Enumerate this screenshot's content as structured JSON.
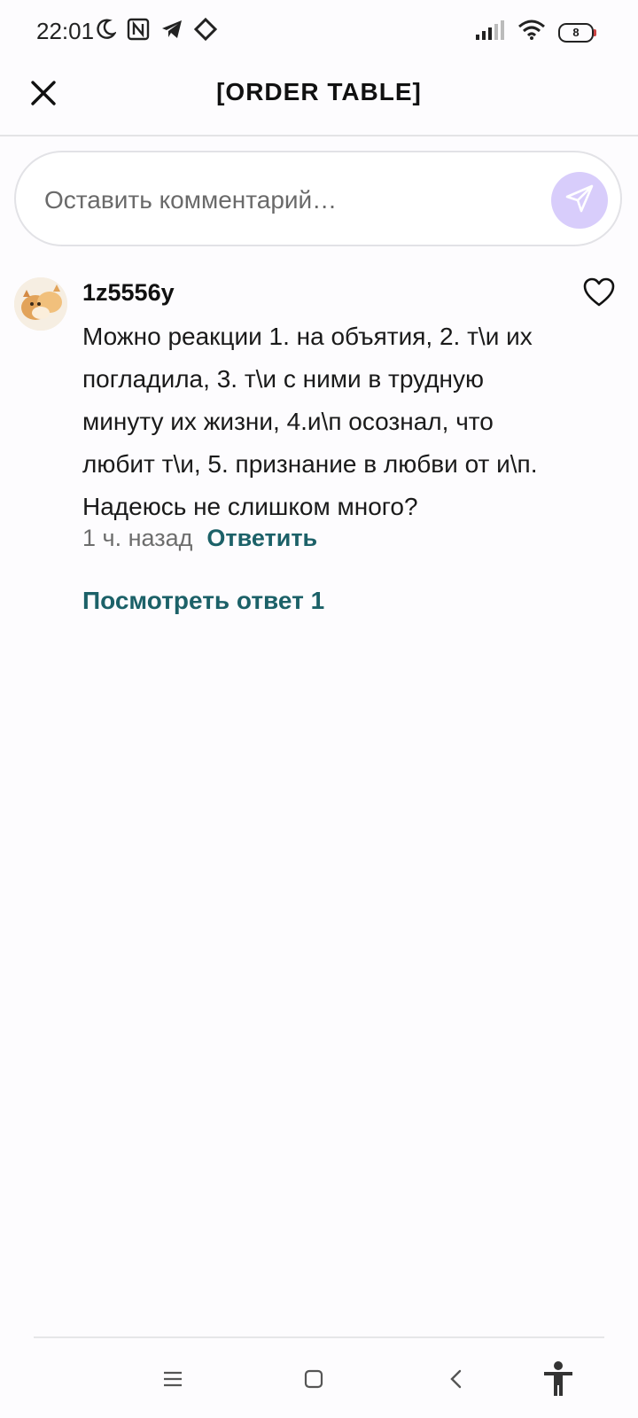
{
  "status_bar": {
    "time": "22:01",
    "battery_level": "8",
    "icons": [
      "moon-icon",
      "nfc-icon",
      "telegram-icon",
      "app-icon",
      "signal-icon",
      "wifi-icon",
      "battery-icon"
    ]
  },
  "header": {
    "title": "[ORDER TABLE]",
    "close_icon": "close-icon"
  },
  "comment_input": {
    "placeholder": "Оставить комментарий…",
    "send_icon": "send-icon",
    "send_color": "#d8cdfb"
  },
  "comment": {
    "username": "1z5556y",
    "text": "Можно реакции 1. на объятия, 2. т\\и их погладила, 3. т\\и с ними в трудную минуту их жизни, 4.и\\п осознал, что любит т\\и, 5. признание в любви от и\\п. Надеюсь не слишком много?",
    "time": "1 ч. назад",
    "reply_label": "Ответить",
    "view_replies_label": "Посмотреть ответ 1",
    "accent_color": "#1c6168"
  },
  "nav_bar": {
    "icons": [
      "menu-icon",
      "home-icon",
      "back-icon",
      "accessibility-icon"
    ]
  }
}
